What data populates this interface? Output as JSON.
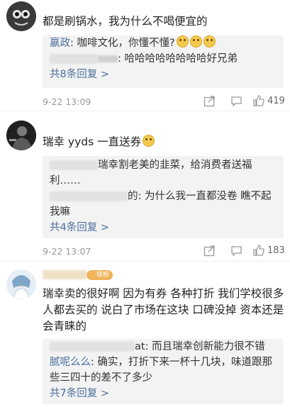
{
  "comments": [
    {
      "text": "都是刷锅水，我为什么不喝便宜的",
      "replies": [
        {
          "user": "嬴政",
          "text": ": 咖啡文化，你懂不懂?"
        },
        {
          "user": "",
          "text": ": 哈哈哈哈哈哈哈哈好兄弟"
        }
      ],
      "more": "共8条回复 >",
      "time": "9-22 13:09",
      "likes": "419"
    },
    {
      "text": "瑞幸 yyds 一直送券",
      "replies": [
        {
          "user": "",
          "text": "瑞幸割老美的韭菜，给消费者送福利……"
        },
        {
          "user": "",
          "text": "的: 为什么我一直都没卷 瞧不起我嘛"
        }
      ],
      "more": "共4条回复 >",
      "time": "9-22 13:07",
      "likes": "183"
    },
    {
      "badge": "铁粉",
      "text": "瑞幸卖的很好啊 因为有券 各种打折 我们学校很多人都去买的 说白了市场在这块 口碑没掉 资本还是会青睐的",
      "replies": [
        {
          "user": "",
          "text": "at: 而且瑞幸创新能力很不错"
        },
        {
          "user": "腻呢么么",
          "text": ": 确实，打折下来一杯十几块，味道跟那些三四十的差不了多少"
        }
      ],
      "more": "共7条回复 >"
    }
  ]
}
